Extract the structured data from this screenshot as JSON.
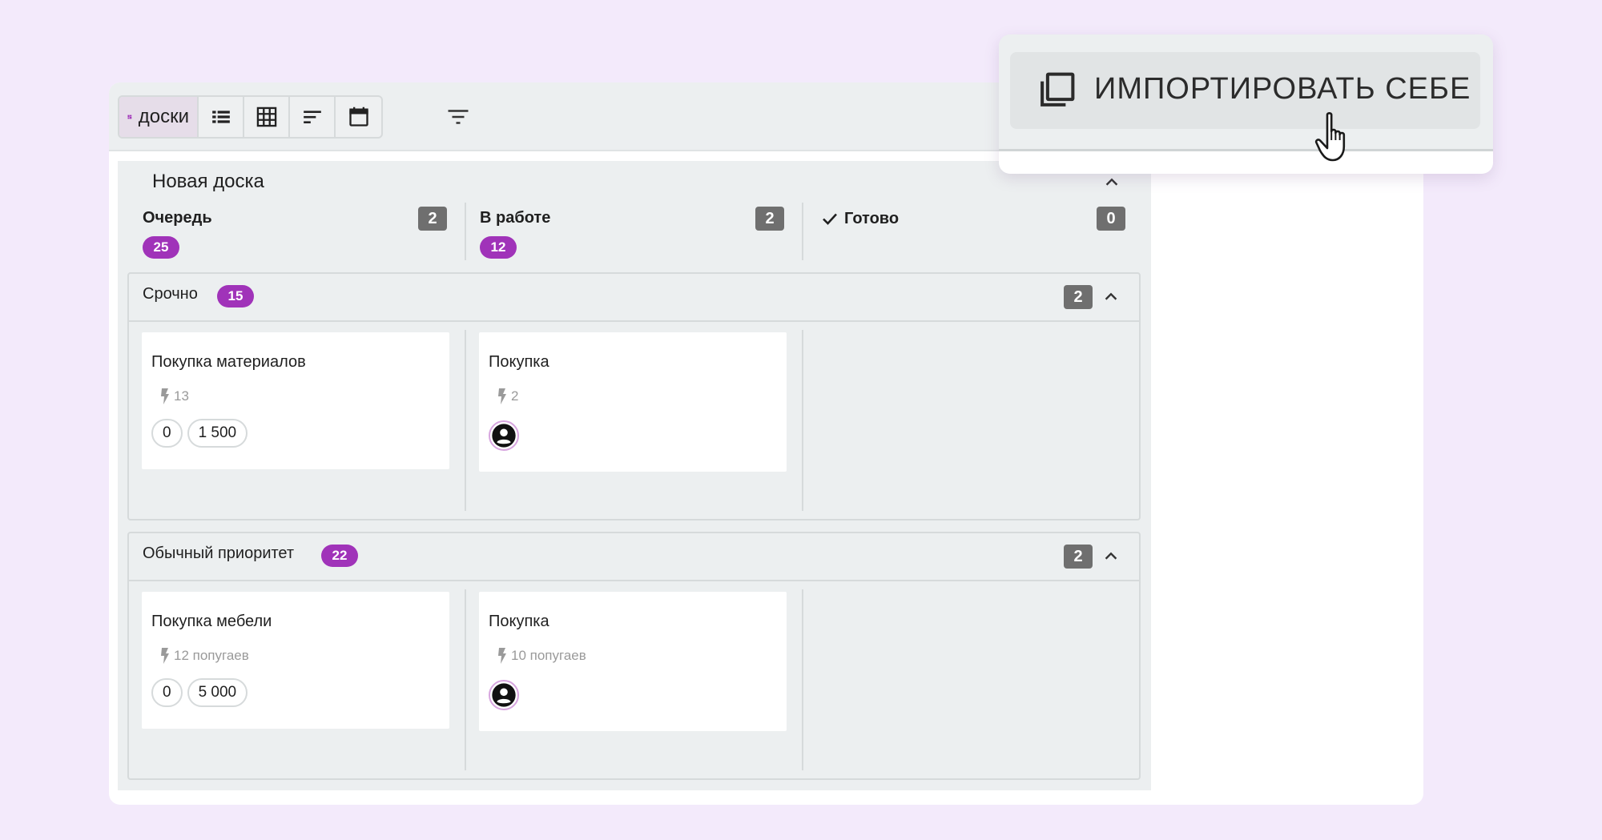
{
  "toolbar": {
    "views": [
      {
        "id": "boards",
        "label": "доски",
        "icon": "board-grid-icon",
        "active": true
      },
      {
        "id": "list",
        "icon": "list-icon"
      },
      {
        "id": "table",
        "icon": "table-icon"
      },
      {
        "id": "gantt",
        "icon": "gantt-icon"
      },
      {
        "id": "calendar",
        "icon": "calendar-icon"
      }
    ],
    "filter_icon": "filter-icon"
  },
  "board": {
    "title": "Новая доска",
    "columns": [
      {
        "name": "Очередь",
        "count": "2",
        "total": "25"
      },
      {
        "name": "В работе",
        "count": "2",
        "total": "12"
      },
      {
        "name": "Готово",
        "count": "0",
        "icon": "check-icon"
      }
    ],
    "lanes": [
      {
        "title": "Срочно",
        "total": "15",
        "count": "2",
        "cards": [
          {
            "title": "Покупка материалов",
            "meta": "13",
            "chips": [
              "0",
              "1 500"
            ]
          },
          {
            "title": "Покупка",
            "meta": "2",
            "avatar": true
          }
        ]
      },
      {
        "title": "Обычный приоритет",
        "total": "22",
        "count": "2",
        "cards": [
          {
            "title": "Покупка мебели",
            "meta": "12 попугаев",
            "chips": [
              "0",
              "5 000"
            ]
          },
          {
            "title": "Покупка",
            "meta": "10 попугаев",
            "avatar": true
          }
        ]
      }
    ]
  },
  "popup": {
    "import_label": "ИМПОРТИРОВАТЬ СЕБЕ",
    "icon": "copy-icon"
  },
  "colors": {
    "background": "#f3eafb",
    "accent": "#a033b9",
    "count_badge": "#6f6f6f",
    "panel": "#eceff0"
  }
}
